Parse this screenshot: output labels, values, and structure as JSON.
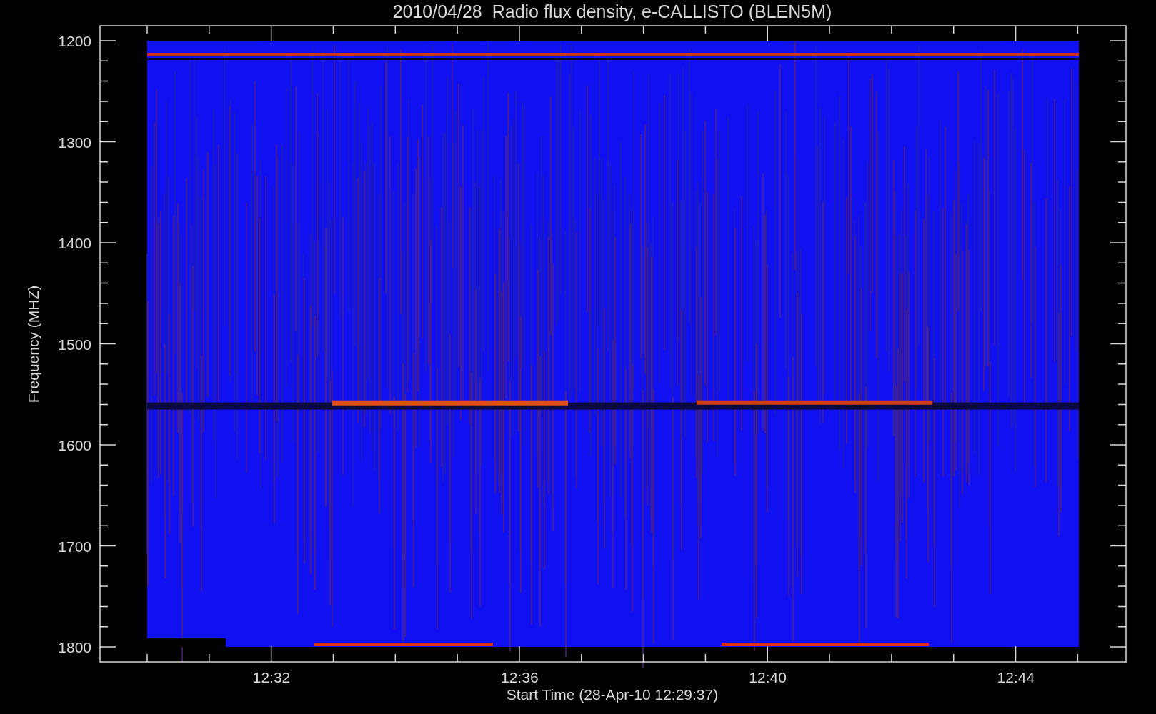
{
  "title": "2010/04/28  Radio flux density, e-CALLISTO (BLEN5M)",
  "y_axis": {
    "label": "Frequency (MHZ)",
    "ticks": [
      "1200",
      "1300",
      "1400",
      "1500",
      "1600",
      "1700",
      "1800"
    ]
  },
  "x_axis": {
    "label": "Start Time (28-Apr-10 12:29:37)",
    "ticks": [
      "12:32",
      "12:36",
      "12:40",
      "12:44"
    ]
  }
}
